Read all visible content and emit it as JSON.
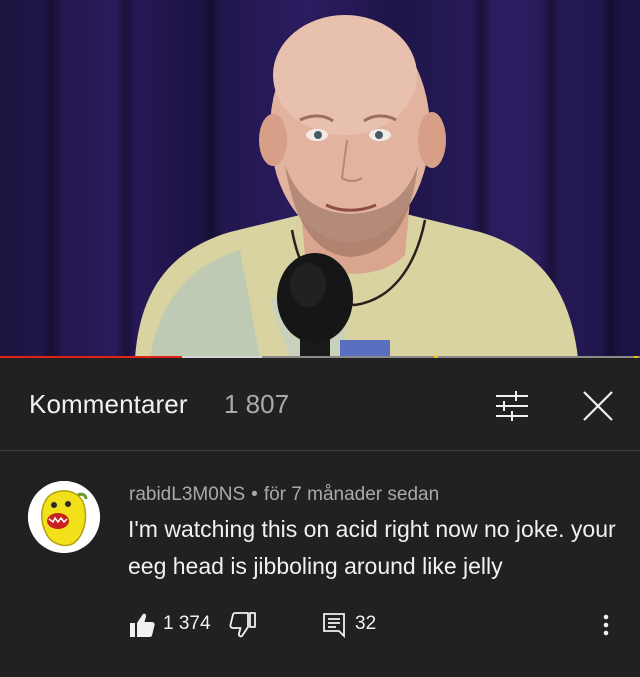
{
  "video": {
    "progress_fraction": 0.285,
    "colors": {
      "progress": "#e52117",
      "curtain": "#2a1a5c"
    }
  },
  "comments_panel": {
    "title": "Kommentarer",
    "count": "1 807",
    "sort_icon": "sort-filter-icon",
    "close_icon": "close-icon"
  },
  "comment": {
    "author": "rabidL3M0NS",
    "separator": "•",
    "timestamp": "för 7 månader sedan",
    "text": "I'm watching this on acid right now no joke. your eeg head is jibboling around like jelly",
    "like_count": "1 374",
    "reply_count": "32",
    "icons": {
      "like": "thumbs-up-icon",
      "dislike": "thumbs-down-icon",
      "reply": "reply-icon",
      "more": "more-vert-icon"
    }
  }
}
